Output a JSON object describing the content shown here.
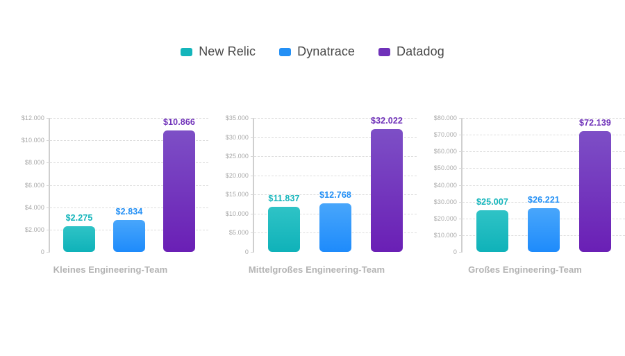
{
  "legend": {
    "items": [
      {
        "label": "New Relic",
        "color": "#14b5bb",
        "icon": "legend-swatch-icon"
      },
      {
        "label": "Dynatrace",
        "color": "#2490f5",
        "icon": "legend-swatch-icon"
      },
      {
        "label": "Datadog",
        "color": "#6f31b9",
        "icon": "legend-swatch-icon"
      }
    ]
  },
  "chart_data": [
    {
      "type": "bar",
      "title": "Kleines Engineering-Team",
      "xlabel": "",
      "ylabel": "",
      "grid": true,
      "legend_position": "top-center",
      "categories": [
        "New Relic",
        "Dynatrace",
        "Datadog"
      ],
      "series": [
        {
          "name": "New Relic",
          "values": [
            2275
          ],
          "color": "#14b5bb"
        },
        {
          "name": "Dynatrace",
          "values": [
            2834
          ],
          "color": "#2490f5"
        },
        {
          "name": "Datadog",
          "values": [
            10866
          ],
          "color": "#6f31b9"
        }
      ],
      "values": [
        2275,
        2834,
        10866
      ],
      "data_labels": [
        "$2.275",
        "$2.834",
        "$10.866"
      ],
      "ylim": [
        0,
        12000
      ],
      "yticks": [
        0,
        2000,
        4000,
        6000,
        8000,
        10000,
        12000
      ],
      "ytick_labels": [
        "0",
        "$2.000",
        "$4.000",
        "$6.000",
        "$8.000",
        "$10.000",
        "$12.000"
      ]
    },
    {
      "type": "bar",
      "title": "Mittelgroßes Engineering-Team",
      "xlabel": "",
      "ylabel": "",
      "grid": true,
      "legend_position": "top-center",
      "categories": [
        "New Relic",
        "Dynatrace",
        "Datadog"
      ],
      "series": [
        {
          "name": "New Relic",
          "values": [
            11837
          ],
          "color": "#14b5bb"
        },
        {
          "name": "Dynatrace",
          "values": [
            12768
          ],
          "color": "#2490f5"
        },
        {
          "name": "Datadog",
          "values": [
            32022
          ],
          "color": "#6f31b9"
        }
      ],
      "values": [
        11837,
        12768,
        32022
      ],
      "data_labels": [
        "$11.837",
        "$12.768",
        "$32.022"
      ],
      "ylim": [
        0,
        35000
      ],
      "yticks": [
        0,
        5000,
        10000,
        15000,
        20000,
        25000,
        30000,
        35000
      ],
      "ytick_labels": [
        "0",
        "$5.000",
        "$10.000",
        "$15.000",
        "$20.000",
        "$25.000",
        "$30.000",
        "$35.000"
      ]
    },
    {
      "type": "bar",
      "title": "Großes Engineering-Team",
      "xlabel": "",
      "ylabel": "",
      "grid": true,
      "legend_position": "top-center",
      "categories": [
        "New Relic",
        "Dynatrace",
        "Datadog"
      ],
      "series": [
        {
          "name": "New Relic",
          "values": [
            25007
          ],
          "color": "#14b5bb"
        },
        {
          "name": "Dynatrace",
          "values": [
            26221
          ],
          "color": "#2490f5"
        },
        {
          "name": "Datadog",
          "values": [
            72139
          ],
          "color": "#6f31b9"
        }
      ],
      "values": [
        25007,
        26221,
        72139
      ],
      "data_labels": [
        "$25.007",
        "$26.221",
        "$72.139"
      ],
      "ylim": [
        0,
        80000
      ],
      "yticks": [
        0,
        10000,
        20000,
        30000,
        40000,
        50000,
        60000,
        70000,
        80000
      ],
      "ytick_labels": [
        "0",
        "$10.000",
        "$20.000",
        "$30.000",
        "$40.000",
        "$50.000",
        "$60.000",
        "$70.000",
        "$80.000"
      ]
    }
  ]
}
